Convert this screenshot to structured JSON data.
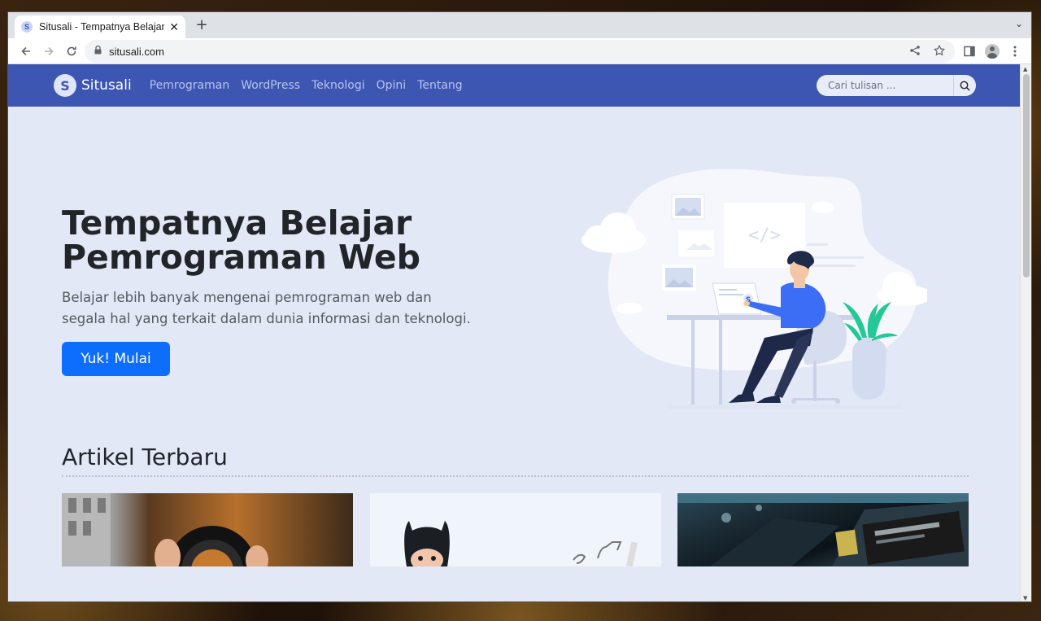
{
  "browser": {
    "tab_title": "Situsali - Tempatnya Belajar",
    "tab_favicon_letter": "S",
    "close_glyph": "✕",
    "new_tab_glyph": "+",
    "tab_menu_glyph": "⌄",
    "url": "situsali.com"
  },
  "site": {
    "brand": "Situsali",
    "logo_letter": "S",
    "nav": [
      "Pemrograman",
      "WordPress",
      "Teknologi",
      "Opini",
      "Tentang"
    ],
    "search_placeholder": "Cari tulisan ..."
  },
  "hero": {
    "title_line1": "Tempatnya Belajar",
    "title_line2": "Pemrograman Web",
    "subtitle_line1": "Belajar lebih banyak mengenai pemrograman web dan",
    "subtitle_line2": "segala hal yang terkait dalam dunia informasi dan teknologi.",
    "cta_label": "Yuk! Mulai"
  },
  "articles": {
    "heading": "Artikel Terbaru"
  },
  "colors": {
    "nav_bg": "#3d56b2",
    "page_bg": "#e3e8f6",
    "cta_bg": "#0d6efd",
    "plant": "#22c997"
  }
}
